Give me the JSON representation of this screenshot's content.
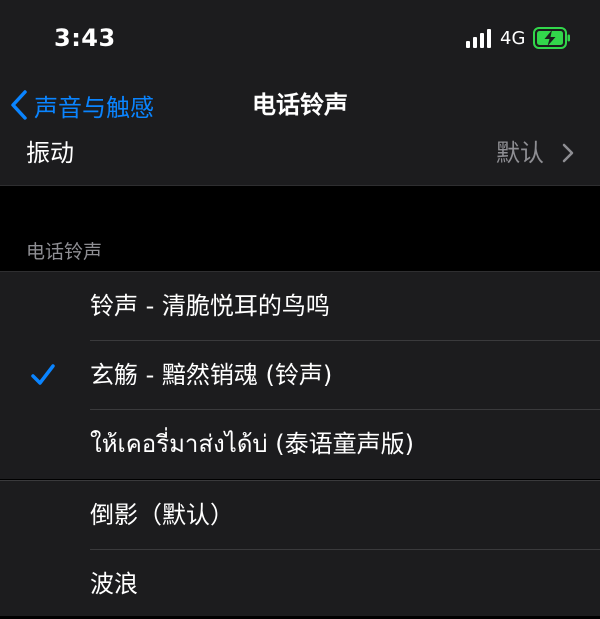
{
  "status_bar": {
    "time": "3:43",
    "network": "4G",
    "battery_charging": true,
    "battery_color": "#32d74b"
  },
  "nav": {
    "back_label": "声音与触感",
    "title": "电话铃声"
  },
  "vibration": {
    "label": "振动",
    "value": "默认"
  },
  "ringtones": {
    "header": "电话铃声",
    "items": [
      {
        "label": "铃声 - 清脆悦耳的鸟鸣",
        "selected": false
      },
      {
        "label": "玄觞 - 黯然销魂 (铃声)",
        "selected": true
      },
      {
        "label": "ให้เคอรี่มาส่งได้บ่ (泰语童声版)",
        "selected": false
      }
    ]
  },
  "system_tones": {
    "items": [
      {
        "label": "倒影（默认）"
      },
      {
        "label": "波浪"
      }
    ]
  },
  "colors": {
    "accent": "#0a84ff",
    "background": "#000000",
    "cell": "#1c1c1e",
    "secondary_text": "#8e8e93"
  }
}
